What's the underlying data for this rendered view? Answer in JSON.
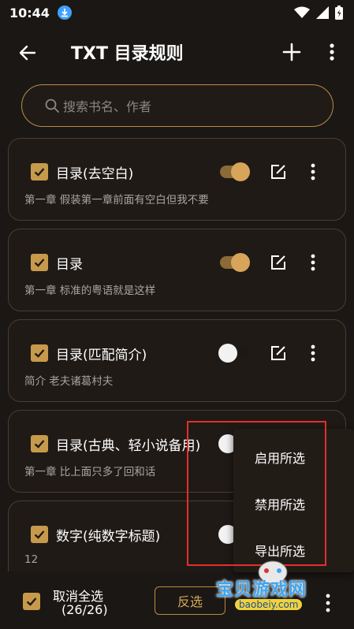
{
  "status_bar": {
    "time": "10:44"
  },
  "appbar": {
    "title": "TXT 目录规则"
  },
  "search": {
    "placeholder": "搜索书名、作者"
  },
  "rules": [
    {
      "name": "目录(去空白)",
      "desc": "第一章 假装第一章前面有空白但我不要",
      "enabled": true,
      "checked": true
    },
    {
      "name": "目录",
      "desc": "第一章 标准的粤语就是这样",
      "enabled": true,
      "checked": true
    },
    {
      "name": "目录(匹配简介)",
      "desc": "简介 老夫诸葛村夫",
      "enabled": false,
      "checked": true
    },
    {
      "name": "目录(古典、轻小说备用)",
      "desc": "第一章 比上面只多了回和话",
      "enabled": false,
      "checked": true
    },
    {
      "name": "数字(纯数字标题)",
      "desc": "12",
      "enabled": false,
      "checked": true
    }
  ],
  "popup_menu": {
    "items": [
      "启用所选",
      "禁用所选",
      "导出所选"
    ]
  },
  "bottom_bar": {
    "select_all_label": "取消全选",
    "count": "(26/26)",
    "invert_label": "反选"
  },
  "watermark": {
    "text": "宝贝游戏网",
    "url": "baobeiy.com"
  },
  "colors": {
    "accent": "#c79a4b",
    "background": "#1b1714",
    "highlight_border": "#e0302c"
  }
}
